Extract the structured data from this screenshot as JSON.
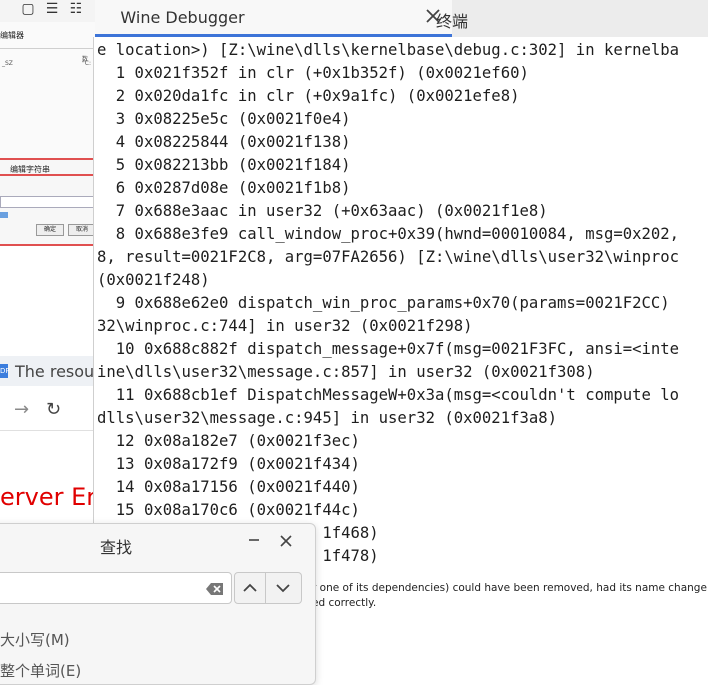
{
  "terminal": {
    "tabs": [
      {
        "label": "Wine Debugger",
        "active": true
      },
      {
        "label": "终端",
        "active": false
      }
    ],
    "lines": [
      "e location>) [Z:\\wine\\dlls\\kernelbase\\debug.c:302] in kernelba",
      "  1 0x021f352f in clr (+0x1b352f) (0x0021ef60)",
      "  2 0x020da1fc in clr (+0x9a1fc) (0x0021efe8)",
      "  3 0x08225e5c (0x0021f0e4)",
      "  4 0x08225844 (0x0021f138)",
      "  5 0x082213bb (0x0021f184)",
      "  6 0x0287d08e (0x0021f1b8)",
      "  7 0x688e3aac in user32 (+0x63aac) (0x0021f1e8)",
      "  8 0x688e3fe9 call_window_proc+0x39(hwnd=00010084, msg=0x202,",
      "8, result=0021F2C8, arg=07FA2656) [Z:\\wine\\dlls\\user32\\winproc",
      "(0x0021f248)",
      "  9 0x688e62e0 dispatch_win_proc_params+0x70(params=0021F2CC)",
      "32\\winproc.c:744] in user32 (0x0021f298)",
      "  10 0x688c882f dispatch_message+0x7f(msg=0021F3FC, ansi=<inte",
      "ine\\dlls\\user32\\message.c:857] in user32 (0x0021f308)",
      "  11 0x688cb1ef DispatchMessageW+0x3a(msg=<couldn't compute lo",
      "dlls\\user32\\message.c:945] in user32 (0x0021f3a8)",
      "  12 0x08a182e7 (0x0021f3ec)",
      "  13 0x08a172f9 (0x0021f434)",
      "  14 0x08a17156 (0x0021f440)",
      "  15 0x08a170c6 (0x0021f44c)",
      "                        1f468)",
      "                        1f478)"
    ]
  },
  "find_dialog": {
    "title": "查找",
    "search_value": "",
    "option_case": "大小写(M)",
    "option_word": "整个单词(E)"
  },
  "background": {
    "regedit_title": "编辑器",
    "regedit_col1": "_SZ",
    "regedit_col2": "\"C:",
    "regedit_head": "数",
    "edit_string_title": "编辑字符串",
    "ok_label": "确定",
    "cancel_label": "取消",
    "browser_tab_icon": "DP",
    "browser_tab_title": "The resou",
    "server_error_text": "erver Er",
    "page_line1": "r one of its dependencies) could have been removed, had its name change",
    "page_line2": "ed correctly."
  },
  "colors": {
    "accent": "#3d74d8",
    "error_text": "#e00000",
    "dialog_rule": "#e05050"
  }
}
